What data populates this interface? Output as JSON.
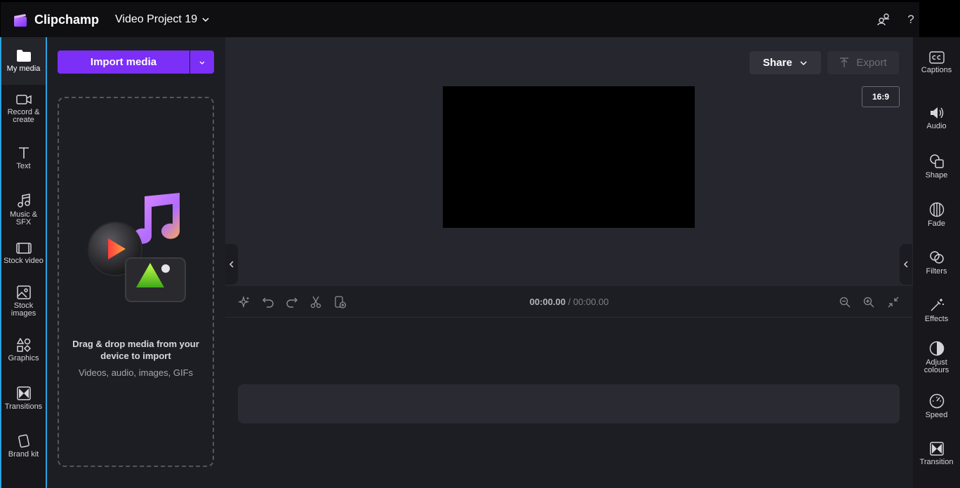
{
  "app": {
    "brand": "Clipchamp",
    "project_title": "Video Project 19",
    "accent_color": "#7b2ff7",
    "highlight_color": "#29a3e0"
  },
  "topbar": {
    "icons": [
      "account-switch-icon",
      "help-icon"
    ],
    "help_glyph": "?"
  },
  "leftnav": {
    "items": [
      {
        "label": "My media",
        "icon": "folder-icon",
        "active": true
      },
      {
        "label": "Record & create",
        "icon": "camera-icon",
        "active": false
      },
      {
        "label": "Text",
        "icon": "text-icon",
        "active": false
      },
      {
        "label": "Music & SFX",
        "icon": "music-icon",
        "active": false
      },
      {
        "label": "Stock video",
        "icon": "film-icon",
        "active": false
      },
      {
        "label": "Stock images",
        "icon": "image-icon",
        "active": false
      },
      {
        "label": "Graphics",
        "icon": "shapes-icon",
        "active": false
      },
      {
        "label": "Transitions",
        "icon": "transition-icon",
        "active": false
      },
      {
        "label": "Brand kit",
        "icon": "brand-kit-icon",
        "active": false
      }
    ]
  },
  "media_panel": {
    "import_label": "Import media",
    "dropzone_title": "Drag & drop media from your device to import",
    "dropzone_subtitle": "Videos, audio, images, GIFs"
  },
  "stage": {
    "share_label": "Share",
    "export_label": "Export",
    "aspect_ratio": "16:9"
  },
  "timeline": {
    "current_time": "00:00.00",
    "separator": " / ",
    "total_time": "00:00.00"
  },
  "rightnav": {
    "items": [
      {
        "label": "Captions",
        "icon": "captions-icon"
      },
      {
        "label": "Audio",
        "icon": "speaker-icon"
      },
      {
        "label": "Shape",
        "icon": "shape-icon"
      },
      {
        "label": "Fade",
        "icon": "fade-icon"
      },
      {
        "label": "Filters",
        "icon": "filters-icon"
      },
      {
        "label": "Effects",
        "icon": "magic-wand-icon"
      },
      {
        "label": "Adjust colours",
        "icon": "contrast-icon"
      },
      {
        "label": "Speed",
        "icon": "speedometer-icon"
      },
      {
        "label": "Transition",
        "icon": "transition-icon"
      }
    ]
  }
}
